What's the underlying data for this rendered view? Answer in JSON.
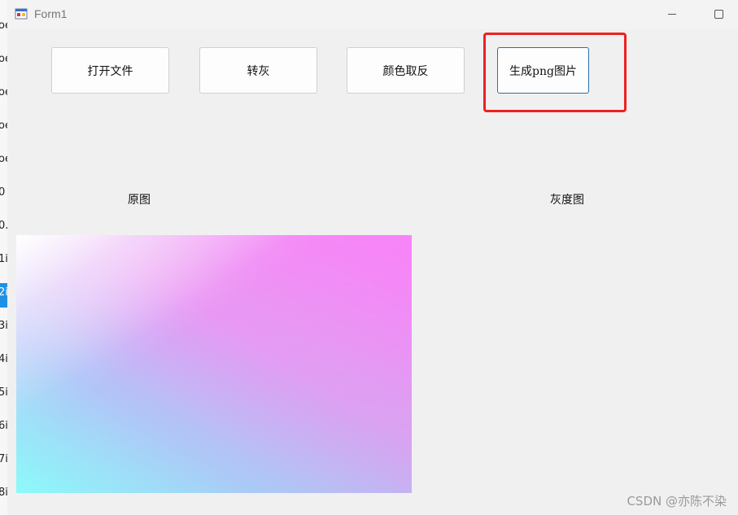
{
  "window": {
    "title": "Form1",
    "icon": "form-app-icon",
    "controls": [
      "minimize-icon",
      "maximize-icon"
    ]
  },
  "background_window": {
    "fragments": [
      "oe",
      "oe",
      "oe",
      "oe",
      "oe",
      "0",
      "0.",
      "1i",
      "2i",
      "3i",
      "4i",
      "5i",
      "6i",
      "7i",
      "8i"
    ]
  },
  "toolbar": {
    "open_file": "打开文件",
    "to_gray": "转灰",
    "invert_color": "颜色取反",
    "generate_png": "生成png图片"
  },
  "labels": {
    "original": "原图",
    "grayscale": "灰度图"
  },
  "watermark": "CSDN @亦陈不染",
  "colors": {
    "highlight": "#ee2020",
    "focused_border": "#2a6fb0",
    "selection_blue": "#1e90e6",
    "gradient_top_right": "#f88ef8",
    "gradient_bottom_left": "#8cfafa"
  }
}
